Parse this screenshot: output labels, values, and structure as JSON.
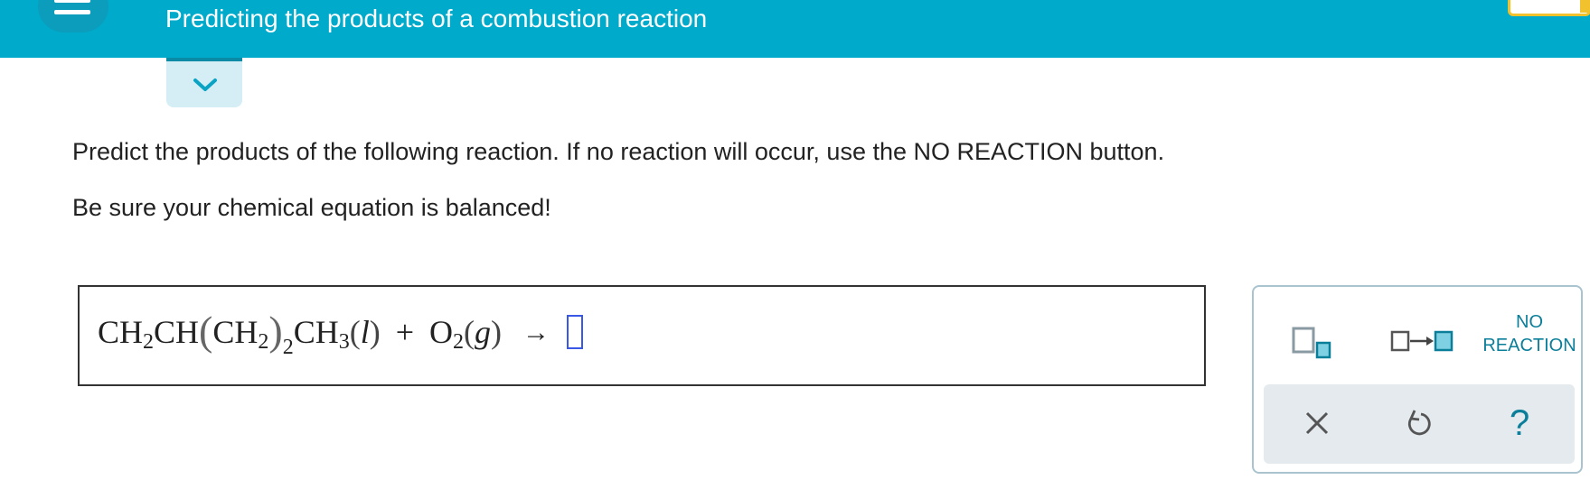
{
  "header": {
    "title": "Predicting the products of a combustion reaction"
  },
  "prompt": {
    "line1": "Predict the products of the following reaction. If no reaction will occur, use the NO REACTION button.",
    "line2": "Be sure your chemical equation is balanced!"
  },
  "equation": {
    "r1_a": "CH",
    "r1_a_sub": "2",
    "r1_b": "CH",
    "r1_c": "CH",
    "r1_c_sub": "2",
    "r1_group_sub": "2",
    "r1_d": "CH",
    "r1_d_sub": "3",
    "r1_state": "l",
    "plus": "+",
    "r2": "O",
    "r2_sub": "2",
    "r2_state": "g",
    "arrow": "→"
  },
  "tools": {
    "no_reaction_line1": "NO",
    "no_reaction_line2": "REACTION",
    "help_label": "?"
  },
  "colors": {
    "header_bg": "#00aacb",
    "accent": "#0b7e9a",
    "slot_border": "#3a58e6"
  }
}
